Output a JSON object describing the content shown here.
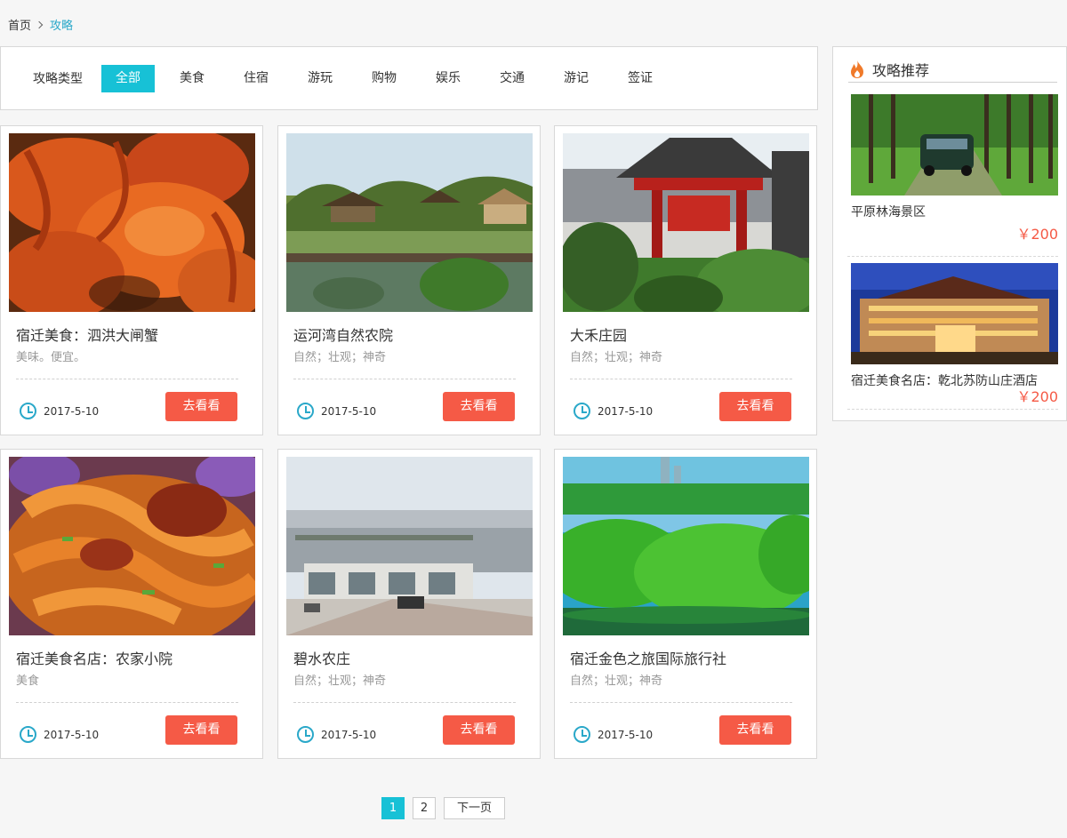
{
  "breadcrumb": {
    "home": "首页",
    "current": "攻略"
  },
  "filter": {
    "title": "攻略类型",
    "items": [
      "全部",
      "美食",
      "住宿",
      "游玩",
      "购物",
      "娱乐",
      "交通",
      "游记",
      "签证"
    ],
    "active_index": 0
  },
  "cards": [
    {
      "title": "宿迁美食：泗洪大闸蟹",
      "tags": "美味。便宜。",
      "date": "2017-5-10",
      "button": "去看看",
      "image": "crab-photo"
    },
    {
      "title": "运河湾自然农院",
      "tags": "自然；壮观；神奇",
      "date": "2017-5-10",
      "button": "去看看",
      "image": "wetland-pavilion-photo"
    },
    {
      "title": "大禾庄园",
      "tags": "自然；壮观；神奇",
      "date": "2017-5-10",
      "button": "去看看",
      "image": "chinese-gate-photo"
    },
    {
      "title": "宿迁美食名店：农家小院",
      "tags": "美食",
      "date": "2017-5-10",
      "button": "去看看",
      "image": "noodle-dish-photo"
    },
    {
      "title": "碧水农庄",
      "tags": "自然；壮观；神奇",
      "date": "2017-5-10",
      "button": "去看看",
      "image": "greenhouse-photo"
    },
    {
      "title": "宿迁金色之旅国际旅行社",
      "tags": "自然；壮观；神奇",
      "date": "2017-5-10",
      "button": "去看看",
      "image": "green-park-photo"
    }
  ],
  "sidebar": {
    "title": "攻略推荐",
    "items": [
      {
        "name": "平原林海景区",
        "price": "￥200",
        "image": "forest-road-photo"
      },
      {
        "name": "宿迁美食名店：乾北苏防山庄酒店",
        "price": "￥200",
        "image": "hotel-night-photo"
      }
    ]
  },
  "pagination": {
    "pages": [
      "1",
      "2"
    ],
    "active": "1",
    "next": "下一页"
  },
  "colors": {
    "accent": "#17c1d6",
    "button": "#f55a46",
    "link": "#2aa8c9"
  }
}
